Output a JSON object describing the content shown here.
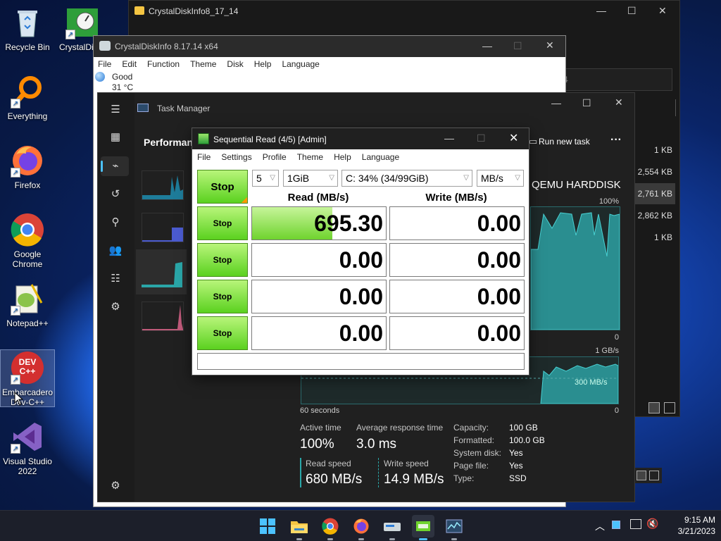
{
  "desktop": {
    "icons": [
      {
        "label": "Recycle Bin",
        "icon": "recycle-bin-icon"
      },
      {
        "label": "CrystalDiskInfo 8",
        "icon": "crystaldiskinfo-icon"
      },
      {
        "label": "Everything",
        "icon": "everything-search-icon"
      },
      {
        "label": "Firefox",
        "icon": "firefox-icon"
      },
      {
        "label": "Google Chrome",
        "icon": "chrome-icon"
      },
      {
        "label": "Notepad++",
        "icon": "notepadpp-icon"
      },
      {
        "label": "Embarcadero Dev-C++",
        "icon": "devcpp-icon",
        "badge": "DEV C++"
      },
      {
        "label": "Visual Studio 2022",
        "icon": "visual-studio-icon"
      }
    ]
  },
  "explorer": {
    "title": "CrystalDiskInfo8_17_14",
    "sizes": [
      "1 KB",
      "2,554 KB",
      "2,761 KB",
      "2,862 KB",
      "1 KB"
    ],
    "partial_text": "4"
  },
  "crystaldiskinfo": {
    "title": "CrystalDiskInfo 8.17.14 x64",
    "menu": [
      "File",
      "Edit",
      "Function",
      "Theme",
      "Disk",
      "Help",
      "Language"
    ],
    "status": "Good",
    "temperature": "31 °C"
  },
  "taskmanager": {
    "title": "Task Manager",
    "section": "Performance",
    "run_new_task": "Run new task",
    "more": "···",
    "disk_name": "QEMU HARDDISK",
    "graph1_max": "100%",
    "graph1_min": "0",
    "graph2_max": "1 GB/s",
    "graph2_min": "0",
    "graph2_ref": "300 MB/s",
    "time_axis": "60 seconds",
    "stats": {
      "active_time_label": "Active time",
      "active_time": "100%",
      "avg_response_label": "Average response time",
      "avg_response": "3.0 ms",
      "read_speed_label": "Read speed",
      "read_speed": "680 MB/s",
      "write_speed_label": "Write speed",
      "write_speed": "14.9 MB/s"
    },
    "props": [
      {
        "label": "Capacity:",
        "value": "100 GB"
      },
      {
        "label": "Formatted:",
        "value": "100.0 GB"
      },
      {
        "label": "System disk:",
        "value": "Yes"
      },
      {
        "label": "Page file:",
        "value": "Yes"
      },
      {
        "label": "Type:",
        "value": "SSD"
      }
    ]
  },
  "diskmark": {
    "title": "Sequential Read (4/5) [Admin]",
    "menu": [
      "File",
      "Settings",
      "Profile",
      "Theme",
      "Help",
      "Language"
    ],
    "all_button": "Stop",
    "count": "5",
    "size": "1GiB",
    "drive": "C: 34% (34/99GiB)",
    "unit": "MB/s",
    "read_header": "Read (MB/s)",
    "write_header": "Write (MB/s)",
    "read_progress": 0.6,
    "rows": [
      {
        "button": "Stop",
        "read": "695.30",
        "write": "0.00"
      },
      {
        "button": "Stop",
        "read": "0.00",
        "write": "0.00"
      },
      {
        "button": "Stop",
        "read": "0.00",
        "write": "0.00"
      },
      {
        "button": "Stop",
        "read": "0.00",
        "write": "0.00"
      }
    ],
    "comment": ""
  },
  "taskbar": {
    "time": "9:15 AM",
    "date": "3/21/2023",
    "apps": [
      "windows-start-icon",
      "file-explorer-icon",
      "chrome-icon",
      "firefox-icon",
      "crystaldiskmark-icon",
      "crystaldiskinfo-icon",
      "task-manager-icon"
    ]
  },
  "colors": {
    "accent_green": "#5bd11f",
    "graph_teal": "#2aa6a8",
    "taskbar_bg": "#1c1f2a"
  }
}
